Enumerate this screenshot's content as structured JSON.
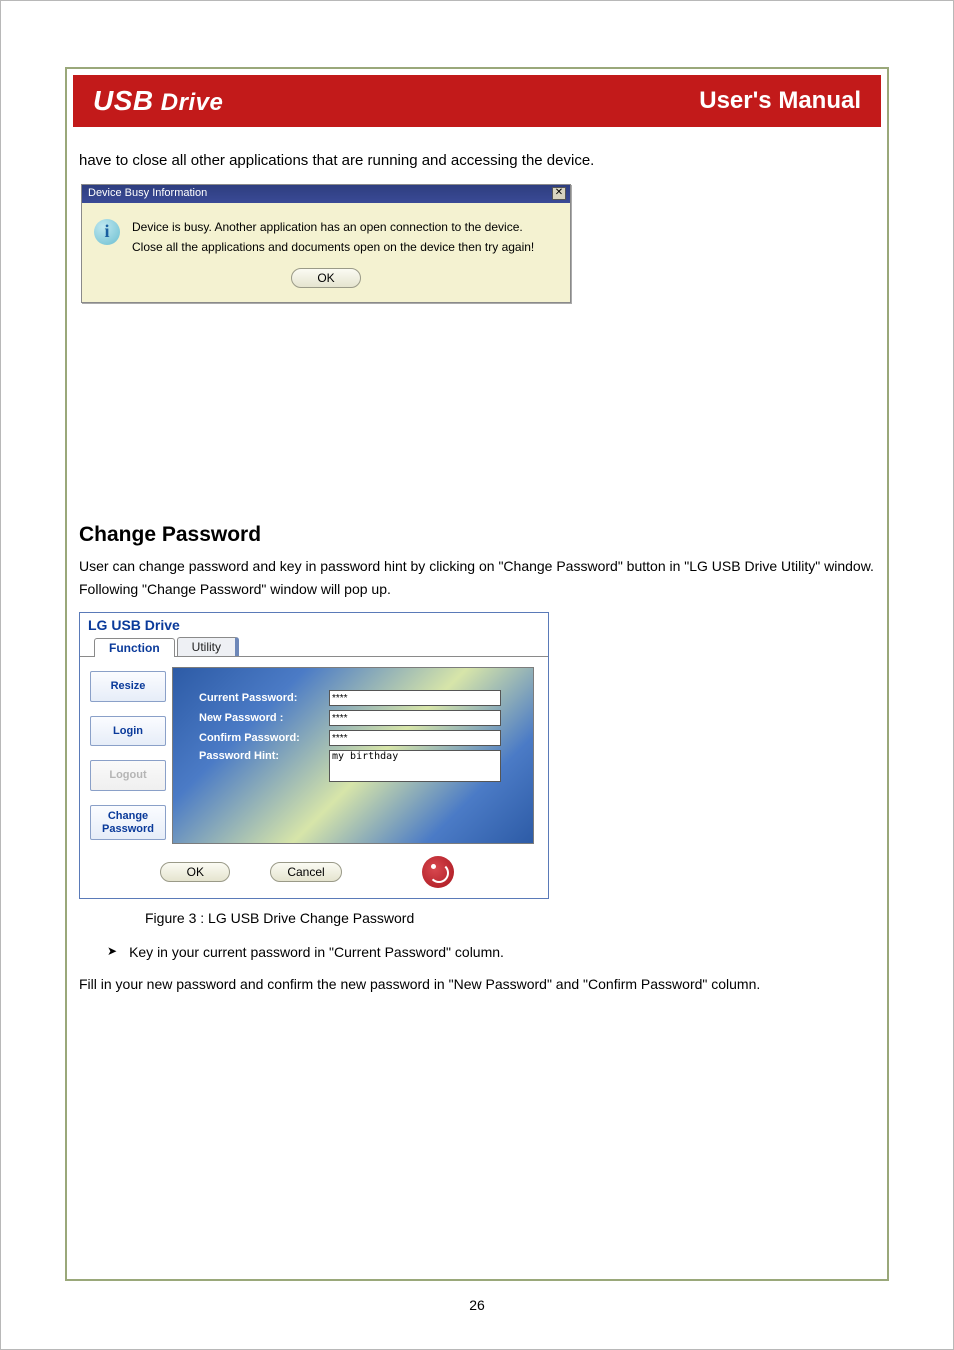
{
  "header": {
    "logo": "USB Drive",
    "title": "User's Manual"
  },
  "para1": "have to close all other applications that are running and accessing the device.",
  "dialog1": {
    "title": "Device Busy Information",
    "msg_line1": "Device is busy. Another application has an open connection to the device.",
    "msg_line2": "Close all the applications and documents open on the device then try again!",
    "ok": "OK"
  },
  "heading": "Change Password",
  "para2": "User can change password and key in password hint by clicking on \"Change Password\" button in \"LG USB Drive Utility\" window. Following \"Change Password\" window will pop up.",
  "dialog2": {
    "title": "LG USB Drive",
    "tabs": {
      "function": "Function",
      "utility": "Utility"
    },
    "side": {
      "resize": "Resize",
      "login": "Login",
      "logout": "Logout",
      "change1": "Change",
      "change2": "Password"
    },
    "form": {
      "current_label": "Current Password:",
      "new_label": "New Password :",
      "confirm_label": "Confirm Password:",
      "hint_label": "Password Hint:",
      "current_val": "****",
      "new_val": "****",
      "confirm_val": "****",
      "hint_val": "my birthday"
    },
    "ok": "OK",
    "cancel": "Cancel"
  },
  "caption": "Figure 3 : LG USB Drive Change Password",
  "bullet": "Key in your current password in \"Current Password\" column.",
  "para3": "Fill in your new password and confirm the new password in \"New Password\" and \"Confirm Password\" column.",
  "page_number": "26"
}
